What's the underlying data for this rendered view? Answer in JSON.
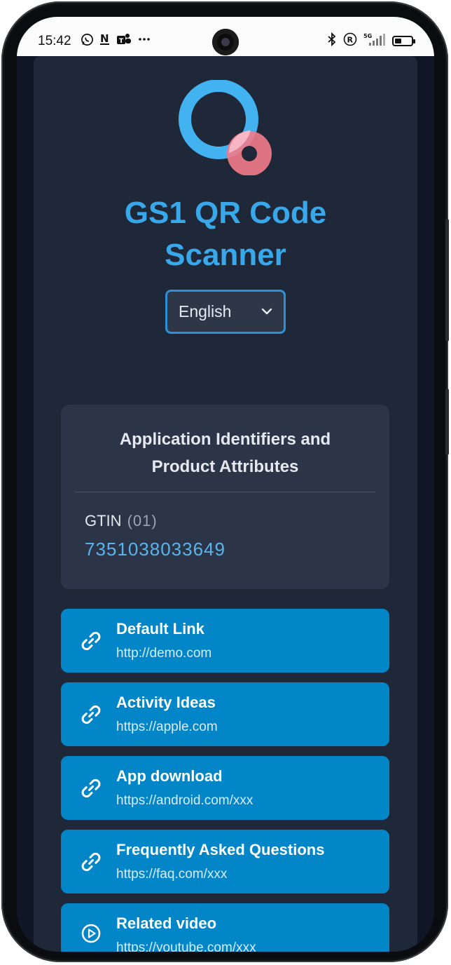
{
  "status_bar": {
    "time": "15:42",
    "left_icons": [
      "whatsapp-icon",
      "n-notification-icon",
      "teams-icon",
      "more-dots-icon"
    ],
    "right_icons": [
      "bluetooth-icon",
      "r-icon",
      "5g-signal-icon",
      "battery-icon"
    ],
    "network": "5G",
    "battery_level": 0.35
  },
  "header": {
    "title_line1": "GS1 QR Code",
    "title_line2": "Scanner",
    "brand_color": "#39a8ea",
    "logo_colors": {
      "ring": "#42b3f0",
      "overlay": "#f27a8a"
    }
  },
  "language_select": {
    "selected": "English"
  },
  "ai_card": {
    "heading_line1": "Application Identifiers and",
    "heading_line2": "Product Attributes",
    "items": [
      {
        "label": "GTIN",
        "code": "(01)",
        "value": "7351038033649"
      }
    ]
  },
  "links": [
    {
      "title": "Default Link",
      "url": "http://demo.com",
      "icon": "link-icon"
    },
    {
      "title": "Activity Ideas",
      "url": "https://apple.com",
      "icon": "link-icon"
    },
    {
      "title": "App download",
      "url": "https://android.com/xxx",
      "icon": "link-icon"
    },
    {
      "title": "Frequently Asked Questions",
      "url": "https://faq.com/xxx",
      "icon": "link-icon"
    },
    {
      "title": "Related video",
      "url": "https://youtube.com/xxx",
      "icon": "play-circle-icon"
    }
  ],
  "colors": {
    "page_bg": "#1f2839",
    "card_bg": "#2c3548",
    "link_bg": "#0286c7",
    "accent": "#5ab4ec"
  }
}
